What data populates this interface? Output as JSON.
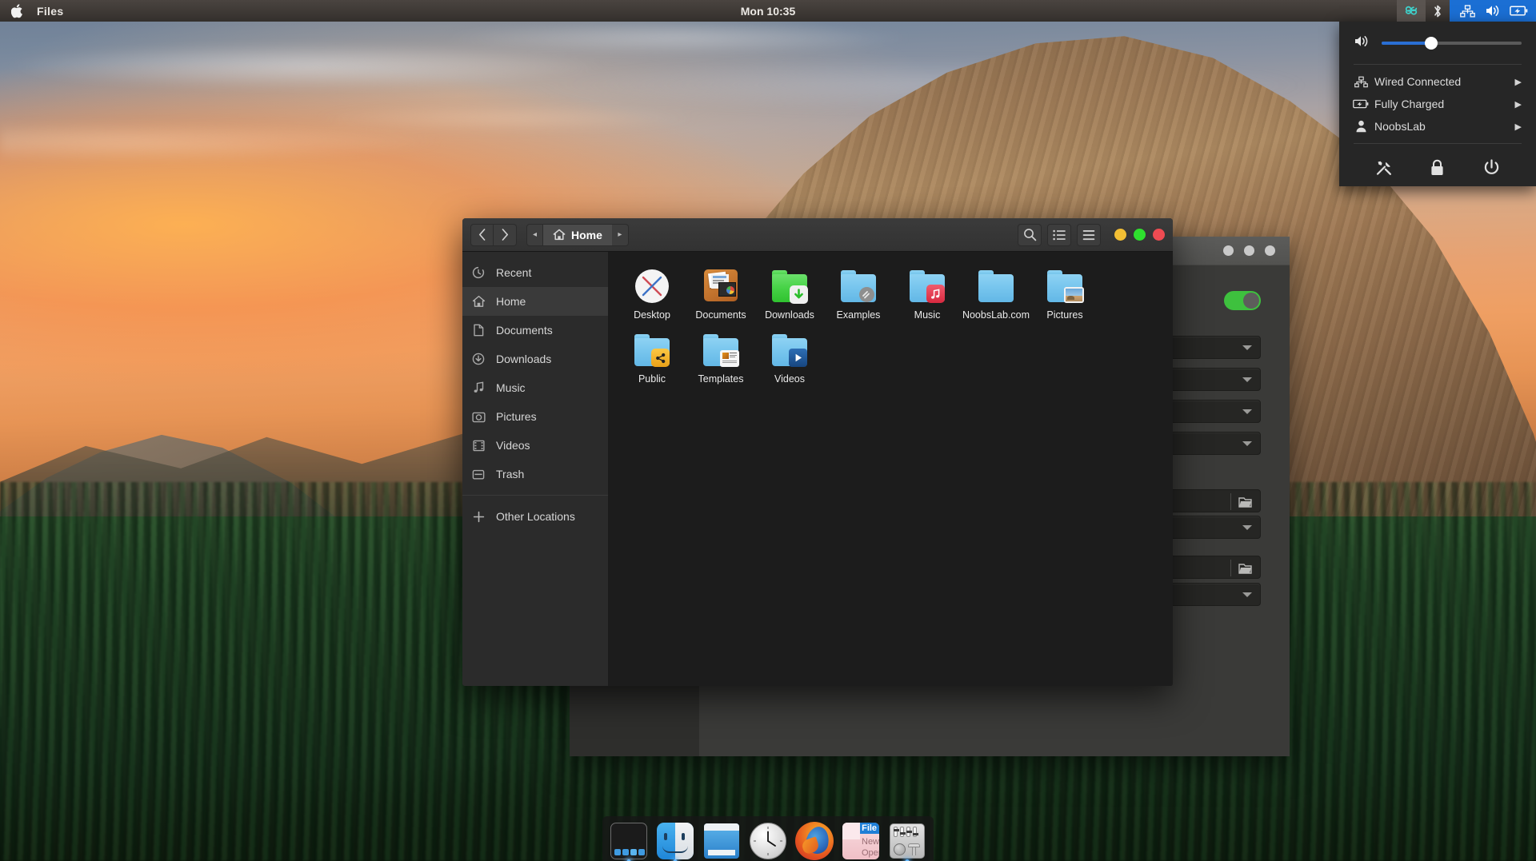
{
  "topbar": {
    "apple_icon": "apple-logo-icon",
    "app_name": "Files",
    "clock": "Mon 10:35",
    "tray": [
      {
        "name": "alpha-indicator-icon",
        "glyph": "∝"
      },
      {
        "name": "bluetooth-icon",
        "glyph": "bluetooth"
      },
      {
        "name": "network-wired-icon",
        "glyph": "network"
      },
      {
        "name": "volume-icon",
        "glyph": "speaker"
      },
      {
        "name": "battery-icon",
        "glyph": "battery"
      }
    ]
  },
  "system_menu": {
    "volume": {
      "icon": "speaker-icon",
      "level_percent": 34
    },
    "items": [
      {
        "icon": "network-wired-icon",
        "label": "Wired Connected",
        "arrow": "▶"
      },
      {
        "icon": "battery-icon",
        "label": "Fully Charged",
        "arrow": "▶"
      },
      {
        "icon": "user-icon",
        "label": "NoobsLab",
        "arrow": "▶"
      }
    ],
    "actions": [
      {
        "icon": "settings-tools-icon",
        "name": "settings-button"
      },
      {
        "icon": "lock-icon",
        "name": "lock-button"
      },
      {
        "icon": "power-icon",
        "name": "power-button"
      }
    ],
    "accent_color": "#2a6fd4",
    "bg_color": "#262626"
  },
  "files_window": {
    "nav": {
      "back": "‹",
      "forward": "›"
    },
    "breadcrumb": {
      "left_arrow": "◂",
      "icon": "home-icon",
      "label": "Home",
      "right_arrow": "▸"
    },
    "header_buttons": [
      {
        "name": "search-button",
        "icon": "search-icon"
      },
      {
        "name": "list-view-button",
        "icon": "list-view-icon"
      },
      {
        "name": "menu-button",
        "icon": "hamburger-menu-icon"
      }
    ],
    "window_controls": [
      {
        "name": "minimize-button",
        "color": "#f3bf34"
      },
      {
        "name": "maximize-button",
        "color": "#2ee02e"
      },
      {
        "name": "close-button",
        "color": "#ef4b52"
      }
    ],
    "sidebar": [
      {
        "label": "Recent",
        "icon": "clock-icon",
        "selected": false
      },
      {
        "label": "Home",
        "icon": "home-icon",
        "selected": true
      },
      {
        "label": "Documents",
        "icon": "document-icon",
        "selected": false
      },
      {
        "label": "Downloads",
        "icon": "download-icon",
        "selected": false
      },
      {
        "label": "Music",
        "icon": "music-note-icon",
        "selected": false
      },
      {
        "label": "Pictures",
        "icon": "camera-icon",
        "selected": false
      },
      {
        "label": "Videos",
        "icon": "film-icon",
        "selected": false
      },
      {
        "label": "Trash",
        "icon": "trash-icon",
        "selected": false
      }
    ],
    "sidebar_footer": {
      "label": "Other Locations",
      "icon": "plus-icon"
    },
    "folders": [
      {
        "label": "Desktop",
        "icon": "desktop-x-icon"
      },
      {
        "label": "Documents",
        "icon": "folder-documents-icon"
      },
      {
        "label": "Downloads",
        "icon": "folder-downloads-icon"
      },
      {
        "label": "Examples",
        "icon": "folder-examples-icon"
      },
      {
        "label": "Music",
        "icon": "folder-music-icon"
      },
      {
        "label": "NoobsLab.com",
        "icon": "folder-plain-icon"
      },
      {
        "label": "Pictures",
        "icon": "folder-pictures-icon"
      },
      {
        "label": "Public",
        "icon": "folder-public-icon"
      },
      {
        "label": "Templates",
        "icon": "folder-templates-icon"
      },
      {
        "label": "Videos",
        "icon": "folder-videos-icon"
      }
    ]
  },
  "background_window": {
    "window_controls": [
      "dot",
      "dot",
      "dot"
    ],
    "toggle": {
      "name": "enable-toggle",
      "state": "on",
      "color": "#3ec13e"
    },
    "combos": [
      {
        "name": "combo-1"
      },
      {
        "name": "combo-2"
      },
      {
        "name": "combo-3"
      },
      {
        "name": "combo-4"
      },
      {
        "name": "combo-5"
      },
      {
        "name": "combo-6"
      }
    ],
    "file_buttons": [
      {
        "name": "file-chooser-1",
        "icon": "folder-open-icon"
      },
      {
        "name": "file-chooser-2",
        "icon": "folder-open-icon"
      }
    ]
  },
  "dock": {
    "items": [
      {
        "name": "launcher-icon",
        "label": "Launcher",
        "running": true
      },
      {
        "name": "finder-icon",
        "label": "Finder",
        "running": true
      },
      {
        "name": "window-manager-icon",
        "label": "Windows",
        "running": false
      },
      {
        "name": "clock-icon",
        "label": "Clock",
        "running": false
      },
      {
        "name": "firefox-icon",
        "label": "Firefox",
        "running": false
      },
      {
        "name": "menu-editor-icon",
        "label": "Menu",
        "running": false
      },
      {
        "name": "tweak-tool-icon",
        "label": "Tweak Tool",
        "running": true
      }
    ],
    "menu_card": {
      "line1": "File",
      "line2": "New",
      "line3": "Open"
    }
  }
}
